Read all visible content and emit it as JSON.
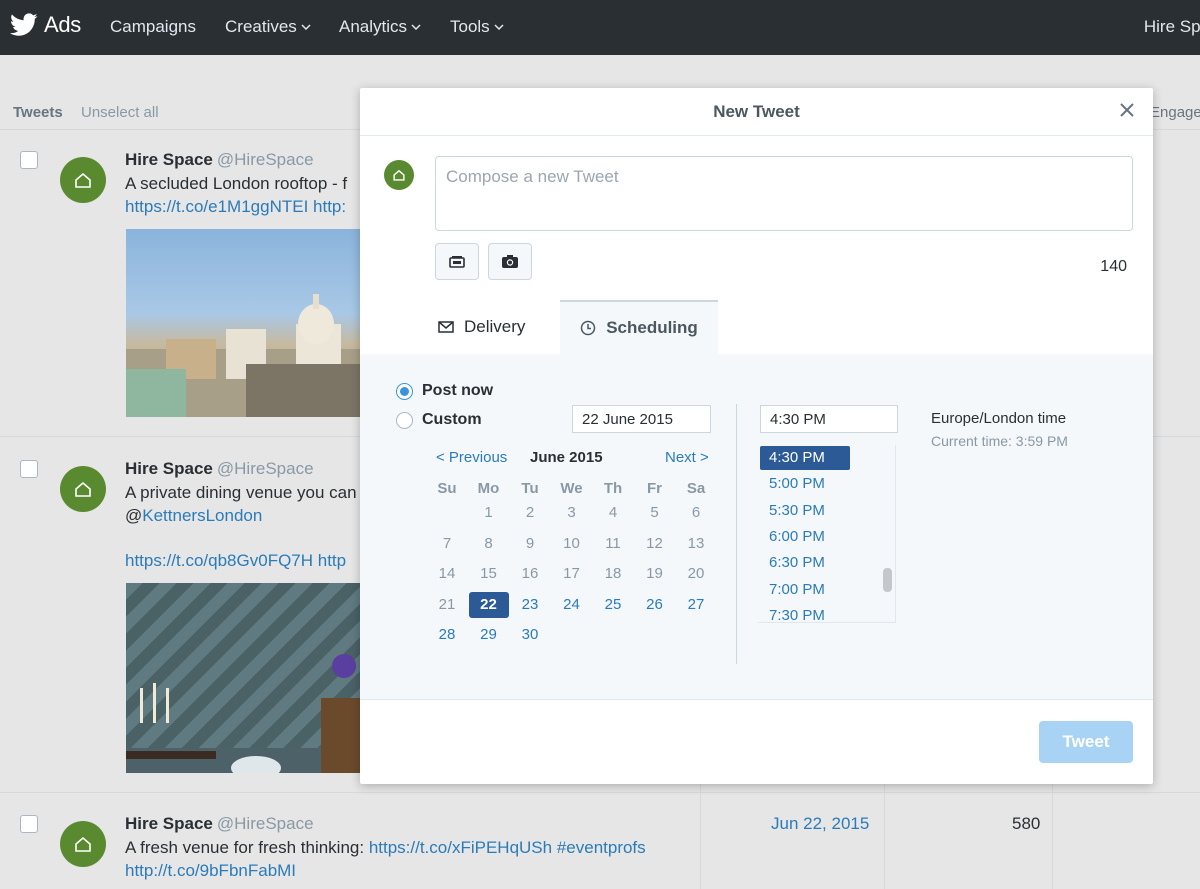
{
  "nav": {
    "brand": "Ads",
    "items": [
      "Campaigns",
      "Creatives",
      "Analytics",
      "Tools"
    ],
    "right": "Hire Spa"
  },
  "background": {
    "tab_tweets": "Tweets",
    "unselect_all": "Unselect all",
    "col_header_partial": "Engagem",
    "tweets": [
      {
        "name": "Hire Space",
        "handle": "@HireSpace",
        "line1": "A secluded London rooftop - f",
        "link1": "https://t.co/e1M1ggNTEI http:"
      },
      {
        "name": "Hire Space",
        "handle": "@HireSpace",
        "line1": "A private dining venue you can",
        "line2_prefix": "@",
        "line2_link": "KettnersLondon",
        "link1": "https://t.co/qb8Gv0FQ7H http"
      },
      {
        "name": "Hire Space",
        "handle": "@HireSpace",
        "line1_prefix": "A fresh venue for fresh thinking: ",
        "line1_link": "https://t.co/xFiPEHqUSh #eventprofs",
        "link2": "http://t.co/9bFbnFabMI",
        "date": "Jun 22, 2015",
        "count": "580"
      }
    ]
  },
  "modal": {
    "title": "New Tweet",
    "compose_placeholder": "Compose a new Tweet",
    "char_count": "140",
    "tabs": {
      "delivery": "Delivery",
      "scheduling": "Scheduling"
    },
    "post_now": "Post now",
    "custom": "Custom",
    "date_value": "22 June 2015",
    "time_value": "4:30 PM",
    "calendar": {
      "prev": "< Previous",
      "next": "Next >",
      "month": "June 2015",
      "dow": [
        "Su",
        "Mo",
        "Tu",
        "We",
        "Th",
        "Fr",
        "Sa"
      ],
      "days": [
        "1",
        "2",
        "3",
        "4",
        "5",
        "6",
        "7",
        "8",
        "9",
        "10",
        "11",
        "12",
        "13",
        "14",
        "15",
        "16",
        "17",
        "18",
        "19",
        "20",
        "21",
        "22",
        "23",
        "24",
        "25",
        "26",
        "27",
        "28",
        "29",
        "30"
      ],
      "selected": "22"
    },
    "times": [
      "4:30 PM",
      "5:00 PM",
      "5:30 PM",
      "6:00 PM",
      "6:30 PM",
      "7:00 PM",
      "7:30 PM"
    ],
    "timezone": "Europe/London time",
    "current_time": "Current time: 3:59 PM",
    "tweet_button": "Tweet"
  },
  "colors": {
    "topnav": "#292f33",
    "link": "#2b7bb9",
    "selected": "#2b5a96",
    "avatar": "#5a8a2f",
    "tweet_button_disabled": "#a9d3f5"
  }
}
